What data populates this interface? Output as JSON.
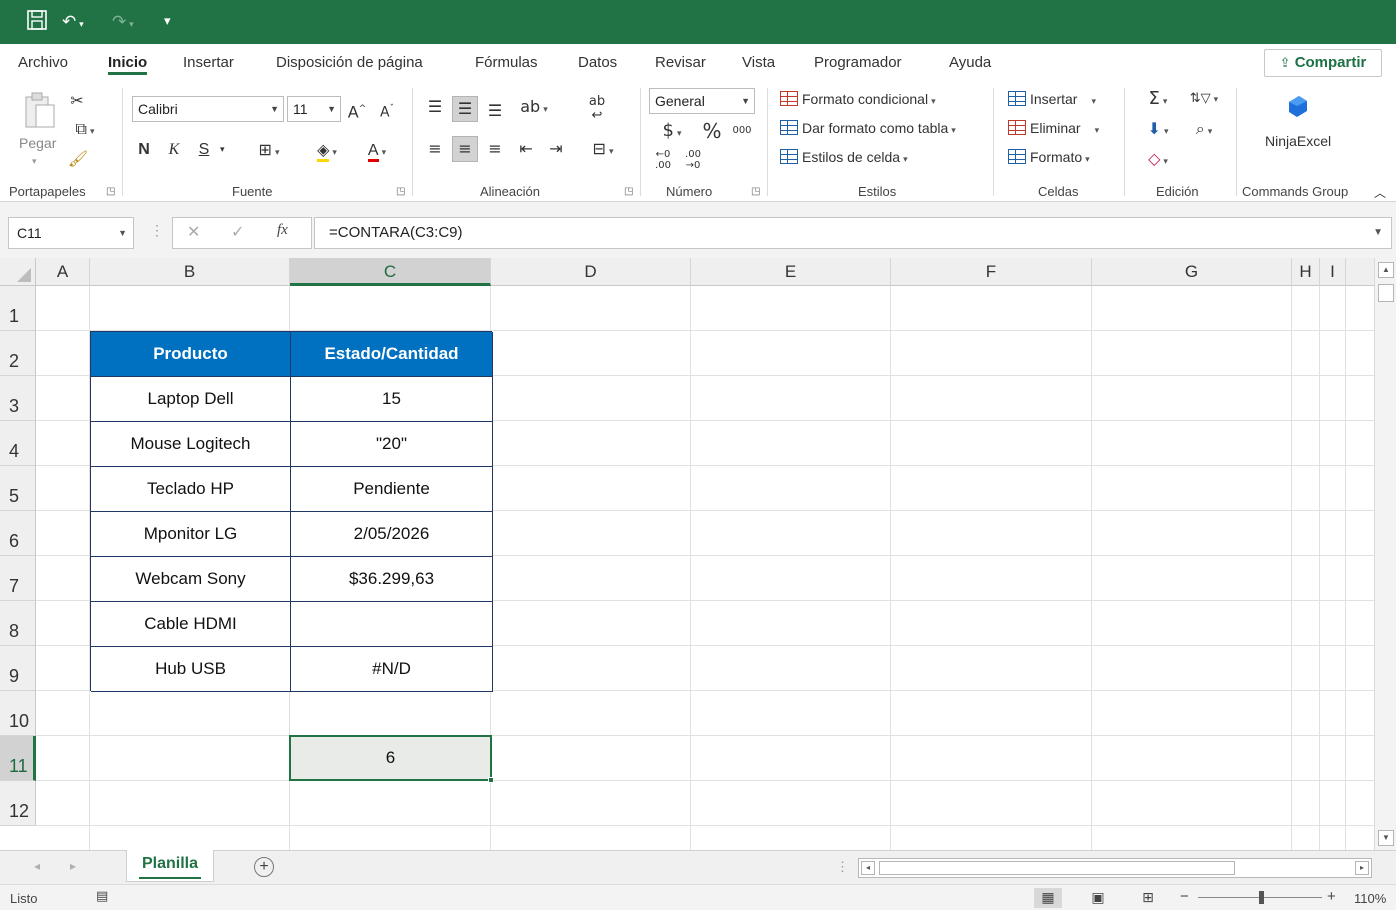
{
  "qat": {
    "undo_icon": "undo-icon",
    "redo_icon": "redo-icon",
    "save_icon": "save-icon"
  },
  "menu": {
    "tabs": [
      "Archivo",
      "Inicio",
      "Insertar",
      "Disposición de página",
      "Fórmulas",
      "Datos",
      "Revisar",
      "Vista",
      "Programador",
      "Ayuda"
    ],
    "active": "Inicio",
    "share_label": "Compartir"
  },
  "ribbon": {
    "clipboard": {
      "paste": "Pegar",
      "label": "Portapapeles"
    },
    "font": {
      "name": "Calibri",
      "size": "11",
      "bold": "N",
      "italic": "K",
      "underline": "S",
      "label": "Fuente"
    },
    "alignment": {
      "label": "Alineación"
    },
    "number": {
      "format": "General",
      "label": "Número"
    },
    "styles": {
      "conditional": "Formato condicional",
      "as_table": "Dar formato como tabla",
      "cell_styles": "Estilos de celda",
      "label": "Estilos"
    },
    "cells": {
      "insert": "Insertar",
      "delete": "Eliminar",
      "format": "Formato",
      "label": "Celdas"
    },
    "editing": {
      "label": "Edición"
    },
    "commands": {
      "ninja": "NinjaExcel",
      "label": "Commands Group"
    }
  },
  "formula_bar": {
    "name_box": "C11",
    "formula": "=CONTARA(C3:C9)",
    "fx": "fx"
  },
  "columns": [
    "A",
    "B",
    "C",
    "D",
    "E",
    "F",
    "G",
    "H",
    "I"
  ],
  "selected_column": "C",
  "rows": [
    "1",
    "2",
    "3",
    "4",
    "5",
    "6",
    "7",
    "8",
    "9",
    "10",
    "11",
    "12"
  ],
  "selected_row": "11",
  "table": {
    "headers": [
      "Producto",
      "Estado/Cantidad"
    ],
    "rows": [
      [
        "Laptop Dell",
        "15"
      ],
      [
        "Mouse Logitech",
        "\"20\""
      ],
      [
        "Teclado HP",
        "Pendiente"
      ],
      [
        "Mponitor LG",
        "2/05/2026"
      ],
      [
        "Webcam Sony",
        "$36.299,63"
      ],
      [
        "Cable HDMI",
        ""
      ],
      [
        "Hub USB",
        "#N/D"
      ]
    ],
    "header_color": "#0070c0"
  },
  "result_cell": {
    "value": "6"
  },
  "sheet": {
    "name": "Planilla"
  },
  "status": {
    "mode": "Listo",
    "zoom": "110%"
  },
  "colors": {
    "accent": "#217346"
  }
}
